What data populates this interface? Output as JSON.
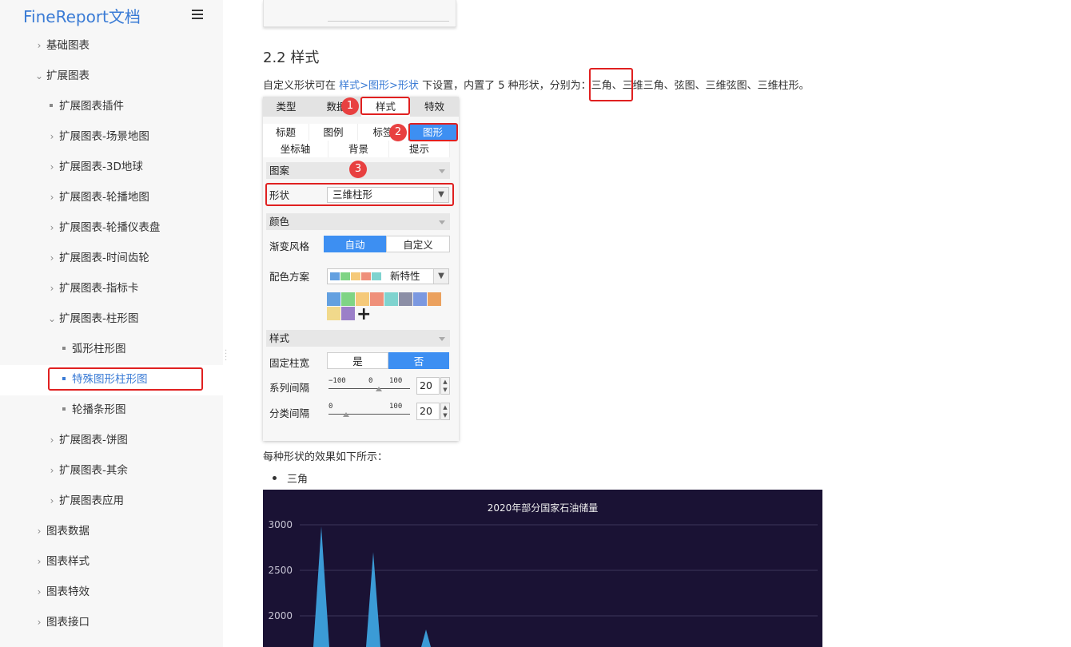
{
  "sidebar": {
    "logo": "FineReport文档",
    "items": [
      {
        "label": "基础图表",
        "type": "collapsed"
      },
      {
        "label": "扩展图表",
        "type": "expanded"
      },
      {
        "label": "扩展图表插件",
        "type": "leaf"
      },
      {
        "label": "扩展图表-场景地图",
        "type": "collapsed"
      },
      {
        "label": "扩展图表-3D地球",
        "type": "collapsed"
      },
      {
        "label": "扩展图表-轮播地图",
        "type": "collapsed"
      },
      {
        "label": "扩展图表-轮播仪表盘",
        "type": "collapsed"
      },
      {
        "label": "扩展图表-时间齿轮",
        "type": "collapsed"
      },
      {
        "label": "扩展图表-指标卡",
        "type": "collapsed"
      },
      {
        "label": "扩展图表-柱形图",
        "type": "expanded"
      },
      {
        "label": "弧形柱形图",
        "type": "leaf"
      },
      {
        "label": "特殊图形柱形图",
        "type": "leaf",
        "active": true
      },
      {
        "label": "轮播条形图",
        "type": "leaf"
      },
      {
        "label": "扩展图表-饼图",
        "type": "collapsed"
      },
      {
        "label": "扩展图表-其余",
        "type": "collapsed"
      },
      {
        "label": "扩展图表应用",
        "type": "collapsed"
      },
      {
        "label": "图表数据",
        "type": "collapsed"
      },
      {
        "label": "图表样式",
        "type": "collapsed"
      },
      {
        "label": "图表特效",
        "type": "collapsed"
      },
      {
        "label": "图表接口",
        "type": "collapsed"
      }
    ]
  },
  "content": {
    "heading": "2.2 样式",
    "para_prefix": "自定义形状可在 ",
    "para_link": "样式>图形>形状",
    "para_mid": " 下设置，内置了 5 种形状，分别为：",
    "para_highlight": "三角",
    "para_suffix": "、三维三角、弦图、三维弦图、三维柱形。",
    "para2": "每种形状的效果如下所示：",
    "bullet1": "三角"
  },
  "panel": {
    "tabs": [
      "类型",
      "数据",
      "样式",
      "特效"
    ],
    "subtabs_row1": [
      "标题",
      "图例",
      "标签",
      "图形"
    ],
    "subtabs_row2": [
      "坐标轴",
      "背景",
      "提示"
    ],
    "section_pattern": "图案",
    "shape_label": "形状",
    "shape_value": "三维柱形",
    "section_color": "颜色",
    "gradient_label": "渐变风格",
    "gradient_auto": "自动",
    "gradient_custom": "自定义",
    "scheme_label": "配色方案",
    "scheme_value": "新特性",
    "section_style": "样式",
    "fixed_width_label": "固定柱宽",
    "yes": "是",
    "no": "否",
    "series_gap_label": "系列间隔",
    "series_gap_min": "−100",
    "series_gap_mid": "0",
    "series_gap_max": "100",
    "series_gap_value": "20",
    "category_gap_label": "分类间隔",
    "category_gap_min": "0",
    "category_gap_max": "100",
    "category_gap_value": "20",
    "badges": [
      "1",
      "2",
      "3"
    ],
    "palette": [
      "#63a0e0",
      "#7fd484",
      "#f5c979",
      "#ef907a",
      "#7fd3cf",
      "#8c8fa6",
      "#7b98e0",
      "#eba15e",
      "#f1d98b",
      "#9b7fc8"
    ]
  },
  "chart_data": {
    "type": "bar",
    "title": "2020年部分国家石油储量",
    "y_ticks": [
      "3000",
      "2500",
      "2000"
    ],
    "ylim_visible": [
      1650,
      3000
    ],
    "visible_values": [
      2980,
      2700,
      1850
    ],
    "colors": {
      "background": "#1a1234",
      "bar": "#3b9bd6"
    }
  }
}
